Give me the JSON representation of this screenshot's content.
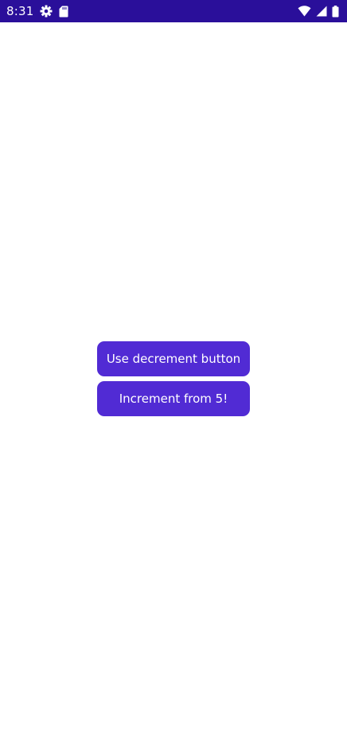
{
  "status_bar": {
    "time": "8:31",
    "background_color": "#2a0f9a",
    "left_icons": [
      "settings-gear-icon",
      "sd-card-icon"
    ],
    "right_icons": [
      "wifi-icon",
      "cell-signal-icon",
      "battery-icon"
    ]
  },
  "main": {
    "button_color": "#512bd4",
    "decrement_label": "Use decrement button",
    "increment_label": "Increment from 5!"
  }
}
